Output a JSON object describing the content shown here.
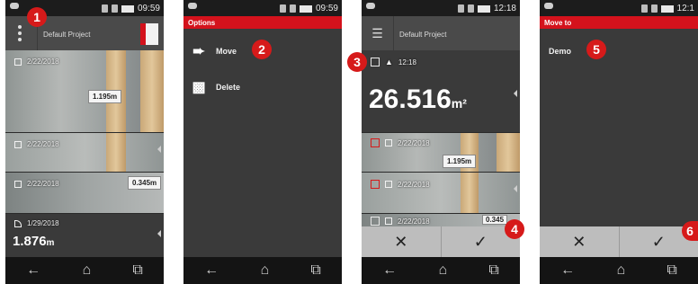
{
  "status": {
    "time_1": "09:59",
    "time_2": "09:59",
    "time_3": "12:18",
    "time_4": "12:1"
  },
  "screen1": {
    "project": "Default Project",
    "items": [
      {
        "date": "2/22/2018",
        "tag": "1.195m"
      },
      {
        "date": "2/22/2018"
      },
      {
        "date": "2/22/2018",
        "tag": "0.345m"
      },
      {
        "date": "1/29/2018",
        "value": "1.876",
        "unit": "m"
      }
    ]
  },
  "screen2": {
    "header": "Options",
    "items": [
      {
        "label": "Move",
        "icon": "move-icon"
      },
      {
        "label": "Delete",
        "icon": "trash-icon"
      }
    ]
  },
  "screen3": {
    "project": "Default Project",
    "time_item": "12:18",
    "big_value": "26.516",
    "big_unit": "m²",
    "items": [
      {
        "date": "2/22/2018",
        "tag": "1.195m"
      },
      {
        "date": "2/22/2018"
      },
      {
        "date": "2/22/2018",
        "tag": "0.345"
      }
    ],
    "cancel": "✕",
    "ok": "✓"
  },
  "screen4": {
    "header": "Move to",
    "item": "Demo",
    "cancel": "✕",
    "ok": "✓"
  },
  "badges": [
    "1",
    "2",
    "3",
    "4",
    "5",
    "6"
  ],
  "nav": {
    "back": "←",
    "home": "⌂",
    "recents": "⧉"
  },
  "colors": {
    "accent": "#d4121c",
    "dark": "#3a3a3a"
  }
}
